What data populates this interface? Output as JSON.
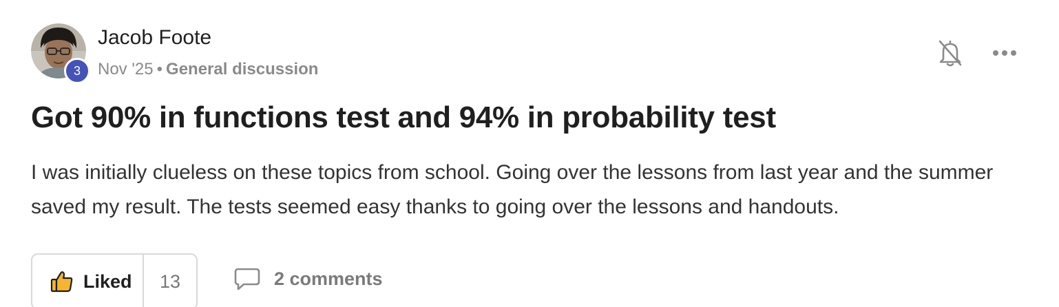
{
  "post": {
    "author": {
      "name": "Jacob Foote",
      "level": "3"
    },
    "date": "Nov '25",
    "separator": "•",
    "category": "General discussion",
    "title": "Got 90% in functions test and 94% in probability test",
    "body": "I was initially clueless on these topics from school. Going over the lessons from last year and the summer saved my result. The tests seemed easy thanks to going over the lessons and handouts.",
    "actions": {
      "like_label": "Liked",
      "like_count": "13",
      "comments_label": "2 comments"
    }
  },
  "icons": {
    "notifications": "bell-off-icon",
    "more": "more-horizontal-icon",
    "like": "thumbs-up-icon",
    "comment": "comment-bubble-icon"
  },
  "colors": {
    "level_badge": "#4353b8",
    "like_icon_fill": "#f5b52e",
    "muted_text": "#8a8a8a",
    "border": "#d9d9d9"
  }
}
